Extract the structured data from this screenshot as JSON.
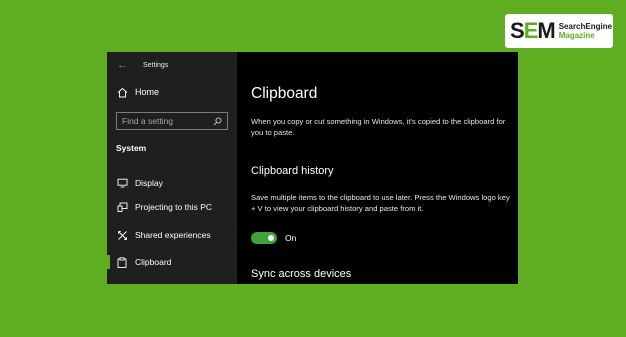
{
  "brand": {
    "mark_s": "S",
    "mark_e": "E",
    "mark_m": "M",
    "line1": "SearchEngine",
    "line2": "Magazine"
  },
  "window": {
    "title": "Settings",
    "back_icon": "back-arrow-icon"
  },
  "sidebar": {
    "home": {
      "label": "Home",
      "icon": "home-icon"
    },
    "search": {
      "placeholder": "Find a setting",
      "value": "",
      "icon": "search-icon"
    },
    "section_title": "System",
    "items": [
      {
        "label": "Display",
        "icon": "monitor-icon",
        "active": false
      },
      {
        "label": "Projecting to this PC",
        "icon": "projector-icon",
        "active": false
      },
      {
        "label": "Shared experiences",
        "icon": "shared-experiences-icon",
        "active": false
      },
      {
        "label": "Clipboard",
        "icon": "clipboard-icon",
        "active": true
      }
    ]
  },
  "main": {
    "title": "Clipboard",
    "intro": "When you copy or cut something in Windows, it's copied to the clipboard for you to paste.",
    "history": {
      "heading": "Clipboard history",
      "description": "Save multiple items to the clipboard to use later. Press the Windows logo key + V to view your clipboard history and paste from it.",
      "toggle_state": "On",
      "toggle_on": true
    },
    "sync": {
      "heading": "Sync across devices"
    }
  },
  "colors": {
    "background": "#5fad21",
    "sidebar": "#1f1f1f",
    "content": "#000000",
    "accent": "#3fa33a"
  }
}
